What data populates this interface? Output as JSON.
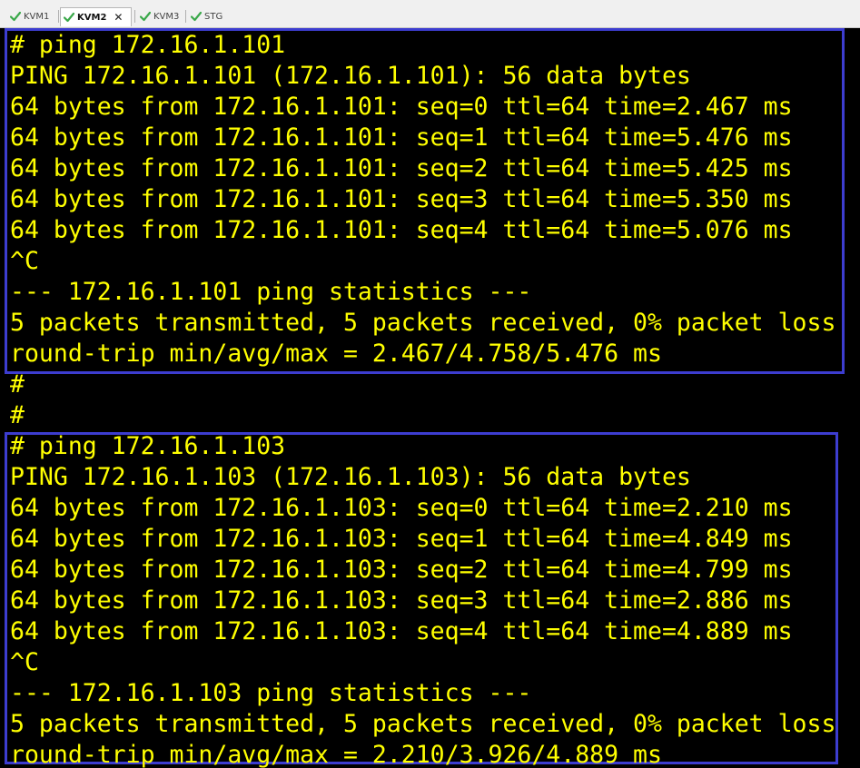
{
  "tabs": [
    {
      "label": "KVM1",
      "active": false
    },
    {
      "label": "KVM2",
      "active": true
    },
    {
      "label": "KVM3",
      "active": false
    },
    {
      "label": "STG",
      "active": false
    }
  ],
  "colors": {
    "terminal_text": "#ffff00",
    "terminal_bg": "#000000",
    "highlight_box": "#3d3dd0",
    "tab_check": "#3aa84a"
  },
  "terminal": {
    "lines": [
      "# ping 172.16.1.101",
      "PING 172.16.1.101 (172.16.1.101): 56 data bytes",
      "64 bytes from 172.16.1.101: seq=0 ttl=64 time=2.467 ms",
      "64 bytes from 172.16.1.101: seq=1 ttl=64 time=5.476 ms",
      "64 bytes from 172.16.1.101: seq=2 ttl=64 time=5.425 ms",
      "64 bytes from 172.16.1.101: seq=3 ttl=64 time=5.350 ms",
      "64 bytes from 172.16.1.101: seq=4 ttl=64 time=5.076 ms",
      "^C",
      "--- 172.16.1.101 ping statistics ---",
      "5 packets transmitted, 5 packets received, 0% packet loss",
      "round-trip min/avg/max = 2.467/4.758/5.476 ms",
      "#",
      "#",
      "# ping 172.16.1.103",
      "PING 172.16.1.103 (172.16.1.103): 56 data bytes",
      "64 bytes from 172.16.1.103: seq=0 ttl=64 time=2.210 ms",
      "64 bytes from 172.16.1.103: seq=1 ttl=64 time=4.849 ms",
      "64 bytes from 172.16.1.103: seq=2 ttl=64 time=4.799 ms",
      "64 bytes from 172.16.1.103: seq=3 ttl=64 time=2.886 ms",
      "64 bytes from 172.16.1.103: seq=4 ttl=64 time=4.889 ms",
      "^C",
      "--- 172.16.1.103 ping statistics ---",
      "5 packets transmitted, 5 packets received, 0% packet loss",
      "round-trip min/avg/max = 2.210/3.926/4.889 ms"
    ]
  }
}
